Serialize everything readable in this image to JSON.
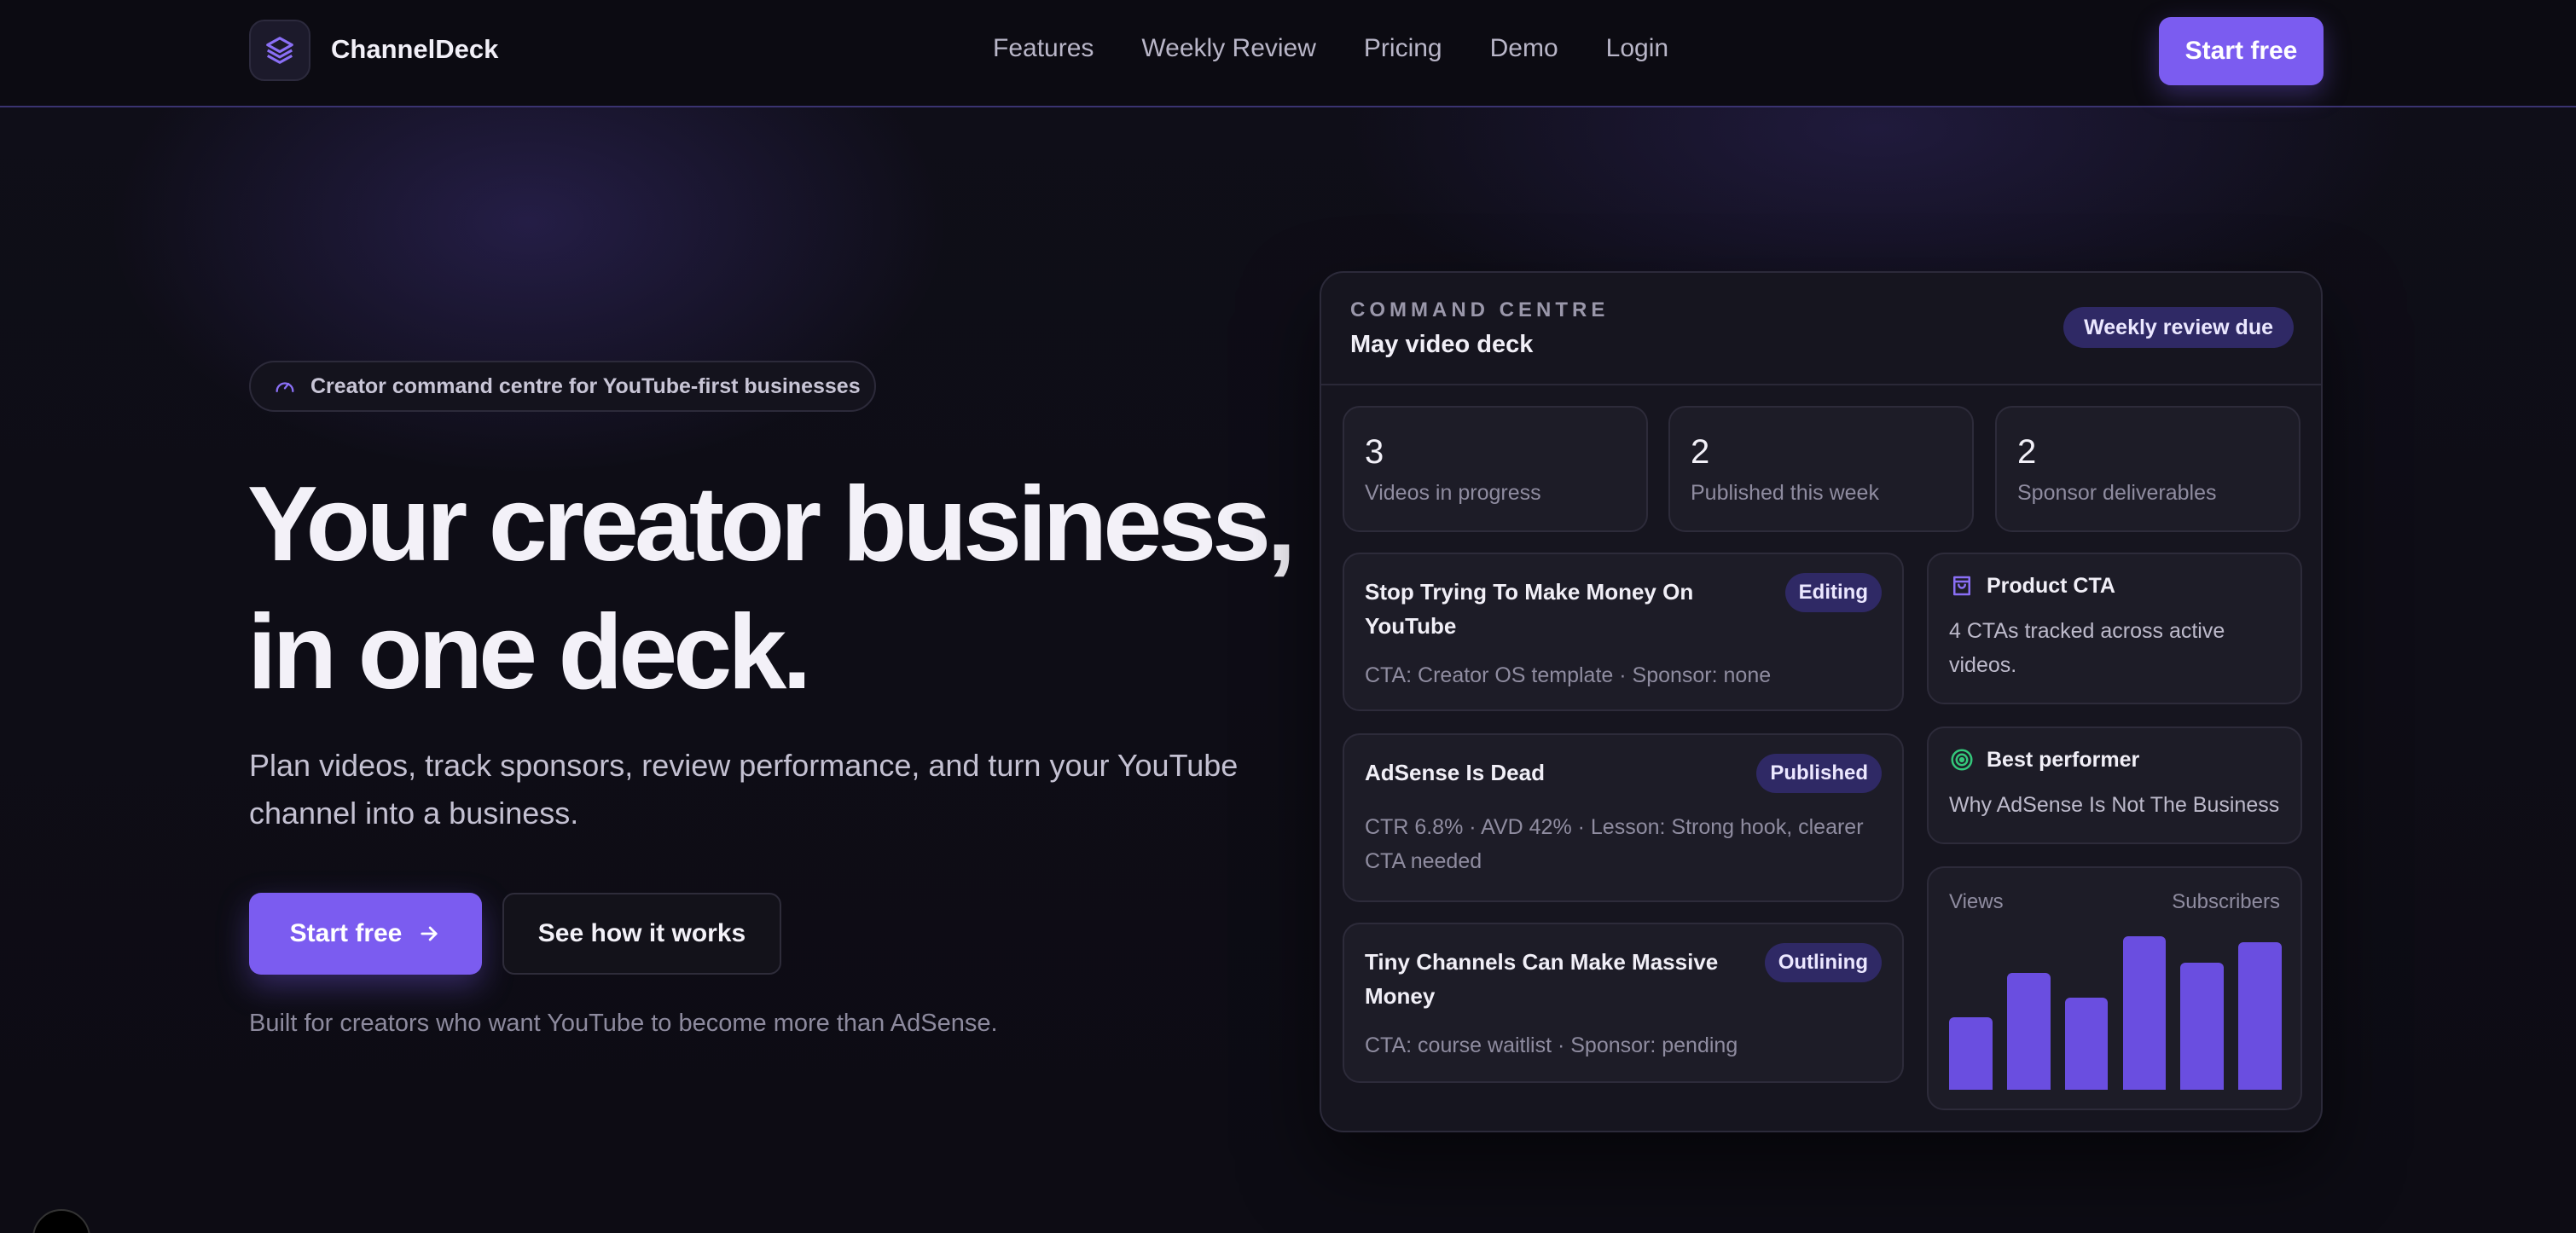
{
  "nav": {
    "brand": "ChannelDeck",
    "links": [
      "Features",
      "Weekly Review",
      "Pricing",
      "Demo",
      "Login"
    ],
    "cta": "Start free"
  },
  "hero": {
    "pill": "Creator command centre for YouTube-first businesses",
    "title_line1": "Your creator business,",
    "title_line2": "in one deck.",
    "subtitle": "Plan videos, track sponsors, review performance, and turn your YouTube channel into a business.",
    "primary_cta": "Start free",
    "secondary_cta": "See how it works",
    "note": "Built for creators who want YouTube to become more than AdSense."
  },
  "deck": {
    "kicker": "COMMAND CENTRE",
    "title": "May video deck",
    "badge": "Weekly review due",
    "stats": [
      {
        "value": "3",
        "label": "Videos in progress"
      },
      {
        "value": "2",
        "label": "Published this week"
      },
      {
        "value": "2",
        "label": "Sponsor deliverables"
      }
    ],
    "videos": [
      {
        "title": "Stop Trying To Make Money On YouTube",
        "status": "Editing",
        "meta": "CTA: Creator OS template · Sponsor: none"
      },
      {
        "title": "AdSense Is Dead",
        "status": "Published",
        "meta": "CTR 6.8% · AVD 42% · Lesson: Strong hook, clearer CTA needed"
      },
      {
        "title": "Tiny Channels Can Make Massive Money",
        "status": "Outlining",
        "meta": "CTA: course waitlist · Sponsor: pending"
      }
    ],
    "product_cta": {
      "title": "Product CTA",
      "body": "4 CTAs tracked across active videos."
    },
    "best_performer": {
      "title": "Best performer",
      "body": "Why AdSense Is Not The Business"
    },
    "chart": {
      "left_label": "Views",
      "right_label": "Subscribers"
    }
  },
  "chart_data": {
    "type": "bar",
    "values": [
      47,
      76,
      60,
      100,
      83,
      96
    ],
    "xlabel": "Views",
    "ylabel": "Subscribers",
    "bar_color": "#6a4ee0"
  },
  "colors": {
    "accent": "#7b5cf0",
    "badge_bg": "#2f2965",
    "best_icon": "#34c77b"
  },
  "icons": {
    "logo": "layers-icon",
    "pill": "gauge-icon",
    "arrow": "arrow-right-icon",
    "product": "bag-icon",
    "best": "target-icon"
  }
}
